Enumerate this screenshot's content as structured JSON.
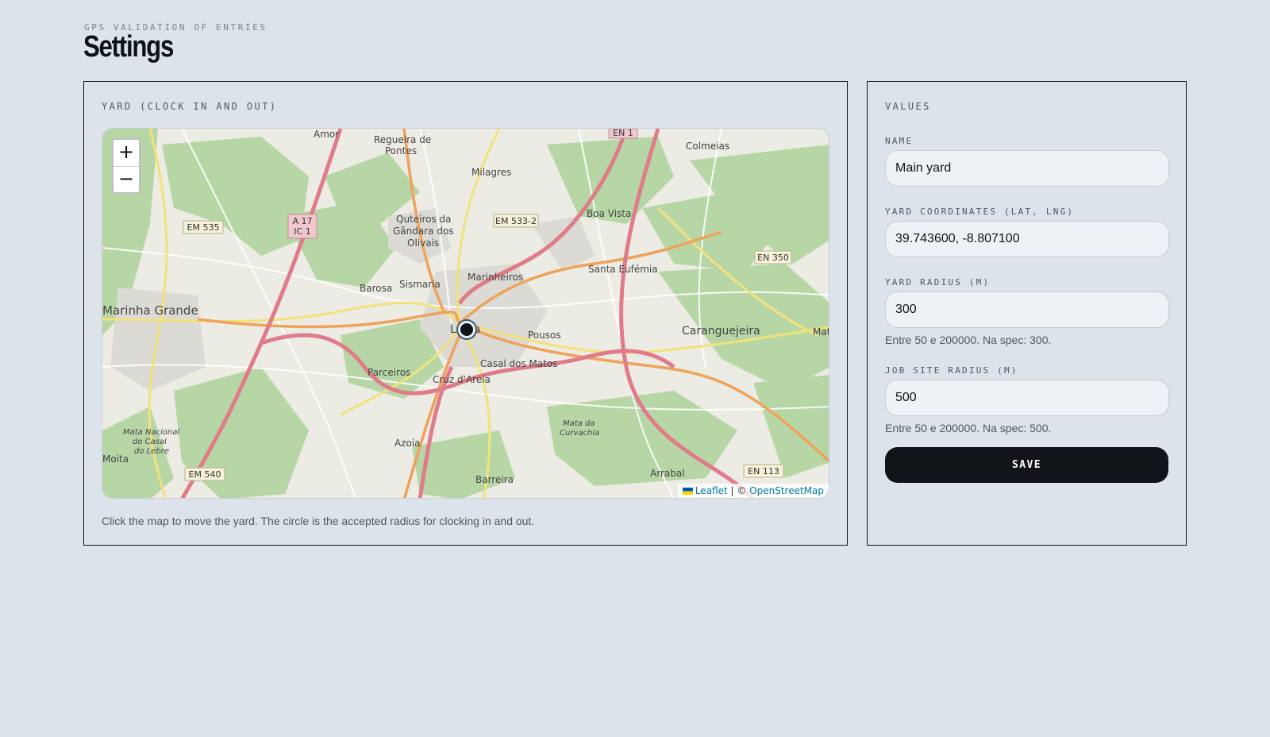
{
  "header": {
    "eyebrow": "GPS VALIDATION OF ENTRIES",
    "title": "Settings"
  },
  "map_panel": {
    "label": "YARD (CLOCK IN AND OUT)",
    "zoom_in": "+",
    "zoom_out": "−",
    "attribution_leaflet": "Leaflet",
    "attribution_sep": "| ©",
    "attribution_osm": "OpenStreetMap",
    "hint": "Click the map to move the yard. The circle is the accepted radius for clocking in and out.",
    "places": [
      "Amor",
      "Regueira de Pontes",
      "Milagres",
      "Colmeias",
      "EN 1",
      "EM 535",
      "A 17",
      "IC 1",
      "Quteiros da Gândara dos Olivais",
      "EM 533-2",
      "Boa Vista",
      "EN 350",
      "Santa Eufémia",
      "Marinheiros",
      "Barosa",
      "Sismaria",
      "Marinha Grande",
      "Leiria",
      "Pousos",
      "Caranguejeira",
      "Parceiros",
      "Casal dos Matos",
      "Cruz d'Areia",
      "Mata Nacional do Casal do Lebre",
      "Mata da Curvachia",
      "Azoia",
      "Moita",
      "EM 540",
      "Barreira",
      "Arrabal",
      "EN 113",
      "Mata"
    ]
  },
  "values_panel": {
    "label": "VALUES",
    "name_label": "NAME",
    "name_value": "Main yard",
    "coords_label": "YARD COORDINATES (LAT, LNG)",
    "coords_value": "39.743600, -8.807100",
    "yard_radius_label": "YARD RADIUS (M)",
    "yard_radius_value": "300",
    "yard_radius_help": "Entre 50 e 200000. Na spec: 300.",
    "job_radius_label": "JOB SITE RADIUS (M)",
    "job_radius_value": "500",
    "job_radius_help": "Entre 50 e 200000. Na spec: 500.",
    "save_label": "SAVE"
  }
}
